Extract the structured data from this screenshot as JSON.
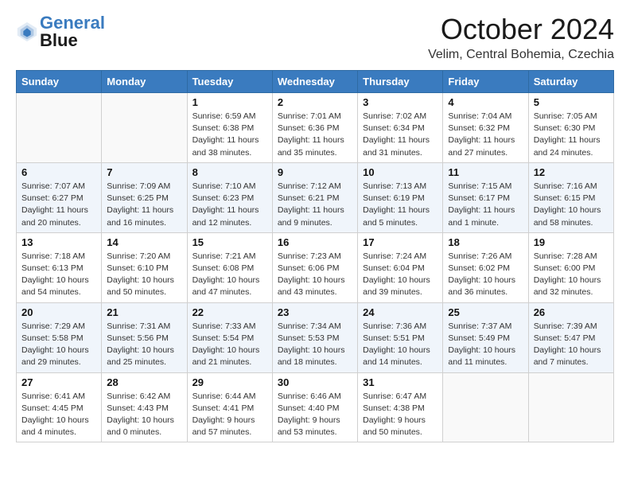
{
  "header": {
    "logo_line1": "General",
    "logo_line2": "Blue",
    "month": "October 2024",
    "location": "Velim, Central Bohemia, Czechia"
  },
  "weekdays": [
    "Sunday",
    "Monday",
    "Tuesday",
    "Wednesday",
    "Thursday",
    "Friday",
    "Saturday"
  ],
  "weeks": [
    [
      {
        "day": "",
        "info": ""
      },
      {
        "day": "",
        "info": ""
      },
      {
        "day": "1",
        "info": "Sunrise: 6:59 AM\nSunset: 6:38 PM\nDaylight: 11 hours and 38 minutes."
      },
      {
        "day": "2",
        "info": "Sunrise: 7:01 AM\nSunset: 6:36 PM\nDaylight: 11 hours and 35 minutes."
      },
      {
        "day": "3",
        "info": "Sunrise: 7:02 AM\nSunset: 6:34 PM\nDaylight: 11 hours and 31 minutes."
      },
      {
        "day": "4",
        "info": "Sunrise: 7:04 AM\nSunset: 6:32 PM\nDaylight: 11 hours and 27 minutes."
      },
      {
        "day": "5",
        "info": "Sunrise: 7:05 AM\nSunset: 6:30 PM\nDaylight: 11 hours and 24 minutes."
      }
    ],
    [
      {
        "day": "6",
        "info": "Sunrise: 7:07 AM\nSunset: 6:27 PM\nDaylight: 11 hours and 20 minutes."
      },
      {
        "day": "7",
        "info": "Sunrise: 7:09 AM\nSunset: 6:25 PM\nDaylight: 11 hours and 16 minutes."
      },
      {
        "day": "8",
        "info": "Sunrise: 7:10 AM\nSunset: 6:23 PM\nDaylight: 11 hours and 12 minutes."
      },
      {
        "day": "9",
        "info": "Sunrise: 7:12 AM\nSunset: 6:21 PM\nDaylight: 11 hours and 9 minutes."
      },
      {
        "day": "10",
        "info": "Sunrise: 7:13 AM\nSunset: 6:19 PM\nDaylight: 11 hours and 5 minutes."
      },
      {
        "day": "11",
        "info": "Sunrise: 7:15 AM\nSunset: 6:17 PM\nDaylight: 11 hours and 1 minute."
      },
      {
        "day": "12",
        "info": "Sunrise: 7:16 AM\nSunset: 6:15 PM\nDaylight: 10 hours and 58 minutes."
      }
    ],
    [
      {
        "day": "13",
        "info": "Sunrise: 7:18 AM\nSunset: 6:13 PM\nDaylight: 10 hours and 54 minutes."
      },
      {
        "day": "14",
        "info": "Sunrise: 7:20 AM\nSunset: 6:10 PM\nDaylight: 10 hours and 50 minutes."
      },
      {
        "day": "15",
        "info": "Sunrise: 7:21 AM\nSunset: 6:08 PM\nDaylight: 10 hours and 47 minutes."
      },
      {
        "day": "16",
        "info": "Sunrise: 7:23 AM\nSunset: 6:06 PM\nDaylight: 10 hours and 43 minutes."
      },
      {
        "day": "17",
        "info": "Sunrise: 7:24 AM\nSunset: 6:04 PM\nDaylight: 10 hours and 39 minutes."
      },
      {
        "day": "18",
        "info": "Sunrise: 7:26 AM\nSunset: 6:02 PM\nDaylight: 10 hours and 36 minutes."
      },
      {
        "day": "19",
        "info": "Sunrise: 7:28 AM\nSunset: 6:00 PM\nDaylight: 10 hours and 32 minutes."
      }
    ],
    [
      {
        "day": "20",
        "info": "Sunrise: 7:29 AM\nSunset: 5:58 PM\nDaylight: 10 hours and 29 minutes."
      },
      {
        "day": "21",
        "info": "Sunrise: 7:31 AM\nSunset: 5:56 PM\nDaylight: 10 hours and 25 minutes."
      },
      {
        "day": "22",
        "info": "Sunrise: 7:33 AM\nSunset: 5:54 PM\nDaylight: 10 hours and 21 minutes."
      },
      {
        "day": "23",
        "info": "Sunrise: 7:34 AM\nSunset: 5:53 PM\nDaylight: 10 hours and 18 minutes."
      },
      {
        "day": "24",
        "info": "Sunrise: 7:36 AM\nSunset: 5:51 PM\nDaylight: 10 hours and 14 minutes."
      },
      {
        "day": "25",
        "info": "Sunrise: 7:37 AM\nSunset: 5:49 PM\nDaylight: 10 hours and 11 minutes."
      },
      {
        "day": "26",
        "info": "Sunrise: 7:39 AM\nSunset: 5:47 PM\nDaylight: 10 hours and 7 minutes."
      }
    ],
    [
      {
        "day": "27",
        "info": "Sunrise: 6:41 AM\nSunset: 4:45 PM\nDaylight: 10 hours and 4 minutes."
      },
      {
        "day": "28",
        "info": "Sunrise: 6:42 AM\nSunset: 4:43 PM\nDaylight: 10 hours and 0 minutes."
      },
      {
        "day": "29",
        "info": "Sunrise: 6:44 AM\nSunset: 4:41 PM\nDaylight: 9 hours and 57 minutes."
      },
      {
        "day": "30",
        "info": "Sunrise: 6:46 AM\nSunset: 4:40 PM\nDaylight: 9 hours and 53 minutes."
      },
      {
        "day": "31",
        "info": "Sunrise: 6:47 AM\nSunset: 4:38 PM\nDaylight: 9 hours and 50 minutes."
      },
      {
        "day": "",
        "info": ""
      },
      {
        "day": "",
        "info": ""
      }
    ]
  ]
}
